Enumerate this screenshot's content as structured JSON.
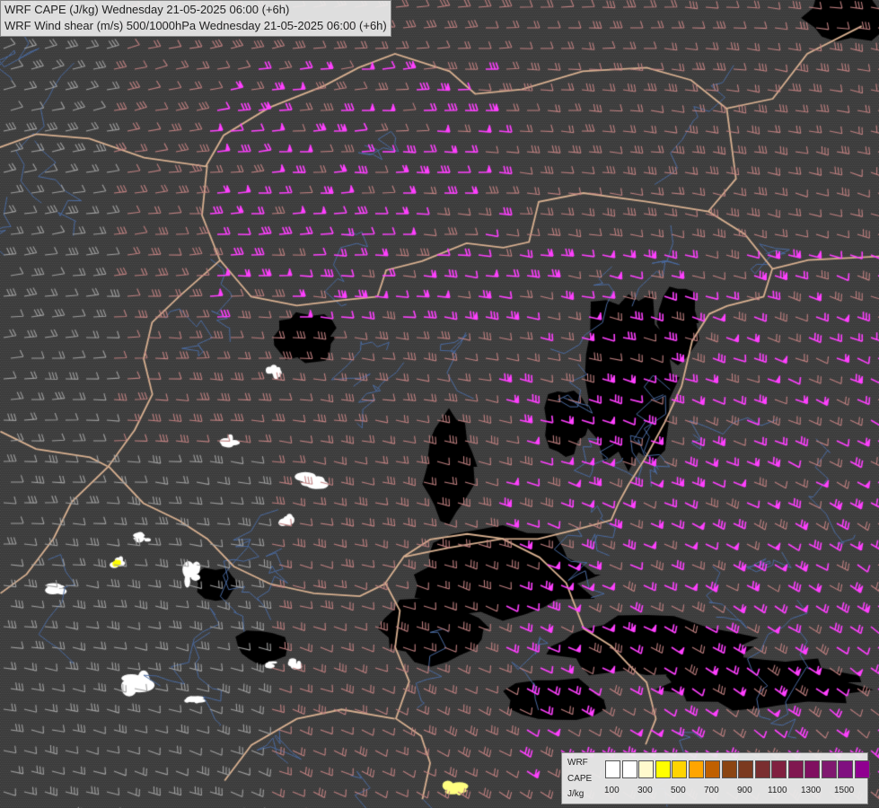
{
  "title": {
    "line1": "WRF CAPE (J/kg) Wednesday 21-05-2025 06:00 (+6h)",
    "line2": "WRF Wind shear (m/s) 500/1000hPa Wednesday 21-05-2025 06:00 (+6h)"
  },
  "legend": {
    "label_line1": "WRF",
    "label_line2": "CAPE",
    "label_line3": "J/kg",
    "ticks": [
      "100",
      "300",
      "500",
      "700",
      "900",
      "1100",
      "1300",
      "1500"
    ],
    "colors": [
      "#ffffff",
      "#ffffff",
      "#fffacd",
      "#ffff00",
      "#ffd400",
      "#ffa500",
      "#c06000",
      "#8b4513",
      "#7b3a20",
      "#7a2e30",
      "#802040",
      "#801850",
      "#801060",
      "#801870",
      "#801080",
      "#900090"
    ]
  },
  "map_colors": {
    "background": "#3a3a3a",
    "cape_black": "#000000",
    "border_line": "#d8b090",
    "river_line": "#4a6aa0",
    "barb_low": "#a0a0a0",
    "barb_mid": "#c08080",
    "barb_high": "#ff40ff"
  }
}
